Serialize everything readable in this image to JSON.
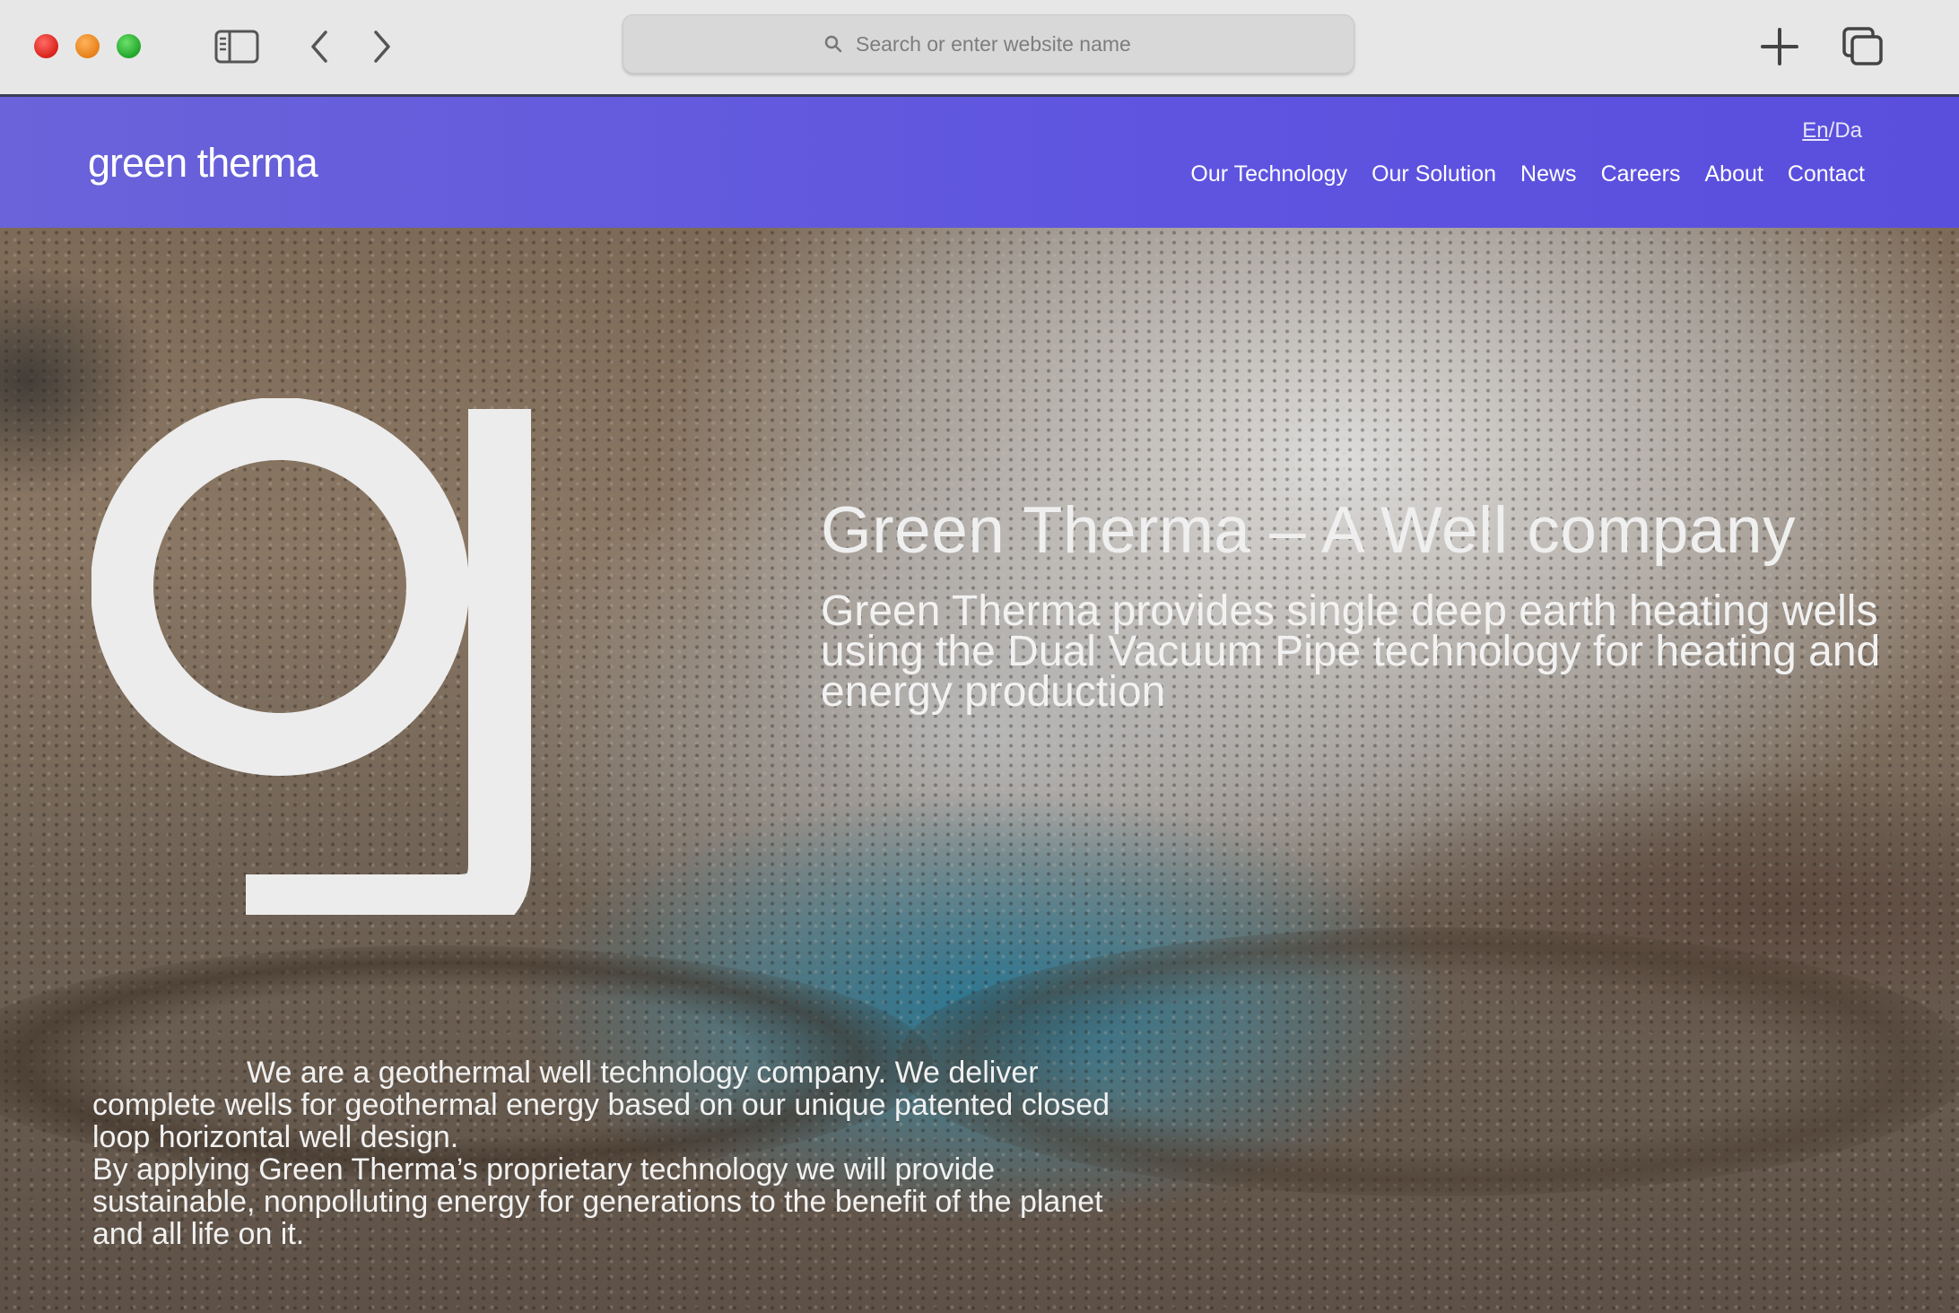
{
  "browser": {
    "search_placeholder": "Search or enter website name",
    "icons": [
      "sidebar-icon",
      "back-arrow-icon",
      "forward-arrow-icon",
      "search-icon",
      "plus-icon",
      "tabs-icon"
    ]
  },
  "site": {
    "logo_text": "green therma",
    "language": {
      "en": "En",
      "separator": "/",
      "da": "Da",
      "selected": "En"
    },
    "nav": [
      "Our Technology",
      "Our Solution",
      "News",
      "Careers",
      "About",
      "Contact"
    ]
  },
  "hero": {
    "headline": "Green Therma – A Well company",
    "subheadline": "Green Therma provides single deep earth heating wells using the Dual Vacuum Pipe technology for heating and energy production",
    "intro": "We are a geothermal well technology company. We deliver complete wells for geothermal energy based on our unique patented closed loop horizontal well design.",
    "intro2": "By applying Green Therma’s proprietary technology we will provide sustainable, nonpolluting energy for generations to the benefit of the planet and all life on it."
  },
  "colors": {
    "header_bg": "#5e54e0",
    "chrome_bg": "#e7e7e7",
    "logo_mark": "#ececec"
  }
}
